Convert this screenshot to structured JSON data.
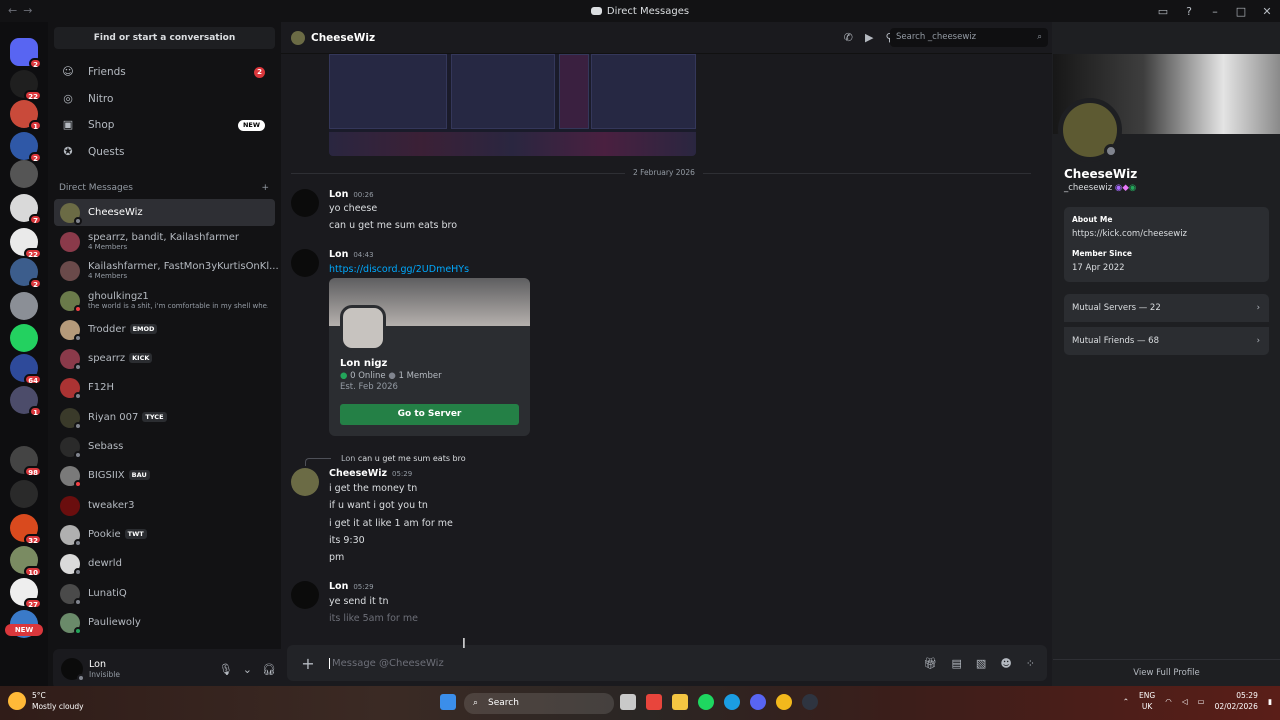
{
  "titlebar": {
    "title": "Direct Messages",
    "back": "←",
    "fwd": "→"
  },
  "servers": [
    {
      "badge": "2",
      "color": "#5865f2"
    },
    {
      "badge": "22",
      "color": "#1f1f1f"
    },
    {
      "badge": "1",
      "color": "#c94a3a"
    },
    {
      "badge": "2",
      "color": "#2f58a7"
    },
    {
      "badge": "",
      "color": "#555555"
    },
    {
      "badge": "7",
      "color": "#d9d9d9"
    },
    {
      "badge": "22",
      "color": "#eaeaea"
    },
    {
      "badge": "2",
      "color": "#3c5d8c"
    },
    {
      "badge": "",
      "color": "#8b8f96"
    },
    {
      "badge": "",
      "color": "#23d160"
    },
    {
      "badge": "64",
      "color": "#2e4a9a"
    },
    {
      "badge": "1",
      "color": "#4c4c6a"
    },
    {
      "badge": "98",
      "color": "#444444"
    },
    {
      "badge": "",
      "color": "#2a2a2a"
    },
    {
      "badge": "32",
      "color": "#d94a1e"
    },
    {
      "badge": "10",
      "color": "#7a8b62"
    },
    {
      "badge": "27",
      "color": "#eeeeee"
    },
    {
      "badge": "",
      "color": "#3a7ac9"
    }
  ],
  "servers_new": "NEW",
  "dmpanel": {
    "search_label": "Find or start a conversation",
    "nav": [
      {
        "label": "Friends",
        "icon": "friends-icon",
        "glyph": "☺",
        "badge": "2"
      },
      {
        "label": "Nitro",
        "icon": "nitro-icon",
        "glyph": "◎",
        "badge": ""
      },
      {
        "label": "Shop",
        "icon": "shop-icon",
        "glyph": "▣",
        "tag": "NEW"
      },
      {
        "label": "Quests",
        "icon": "quests-icon",
        "glyph": "✪",
        "badge": ""
      }
    ],
    "dm_header": "Direct Messages",
    "dm_add": "+",
    "dms": [
      {
        "name": "CheeseWiz",
        "sub": "",
        "tag": "",
        "color": "#6b6b45",
        "status": "#80848e"
      },
      {
        "name": "spearrz, bandit, Kailashfarmer",
        "sub": "4 Members",
        "tag": "",
        "color": "#8a3a4a",
        "status": ""
      },
      {
        "name": "Kailashfarmer, FastMon3yKurtisOnKl...",
        "sub": "4 Members",
        "tag": "",
        "color": "#6a4a4a",
        "status": ""
      },
      {
        "name": "ghoulkingz1",
        "sub": "the world is a shit, i'm comfortable in my shell whe...",
        "tag": "",
        "color": "#6a7a4a",
        "status": "#f23f43"
      },
      {
        "name": "Trodder",
        "sub": "",
        "tag": "EMOD",
        "color": "#b59a7a",
        "status": "#80848e"
      },
      {
        "name": "spearrz",
        "sub": "",
        "tag": "KICK",
        "color": "#8a3a4a",
        "status": "#80848e"
      },
      {
        "name": "F12H",
        "sub": "",
        "tag": "",
        "color": "#aa3333",
        "status": "#80848e"
      },
      {
        "name": "Riyan 007",
        "sub": "",
        "tag": "TYCE",
        "color": "#3a3a2a",
        "status": "#80848e"
      },
      {
        "name": "Sebass",
        "sub": "",
        "tag": "",
        "color": "#2a2a2a",
        "status": "#80848e"
      },
      {
        "name": "BIGSIIX",
        "sub": "",
        "tag": "BAU",
        "color": "#7a7a7a",
        "status": "#f23f43"
      },
      {
        "name": "tweaker3",
        "sub": "",
        "tag": "",
        "color": "#6a0e0e",
        "status": ""
      },
      {
        "name": "Pookie",
        "sub": "",
        "tag": "TWT",
        "color": "#b0b0b0",
        "status": "#80848e"
      },
      {
        "name": "dewrld",
        "sub": "",
        "tag": "",
        "color": "#dadada",
        "status": "#80848e"
      },
      {
        "name": "LunatiQ",
        "sub": "",
        "tag": "",
        "color": "#4a4a4a",
        "status": "#80848e"
      },
      {
        "name": "Pauliewoly",
        "sub": "",
        "tag": "",
        "color": "#6a8a6a",
        "status": "#23a55a"
      }
    ],
    "user": {
      "name": "Lon",
      "status": "Invisible"
    }
  },
  "chat": {
    "name": "CheeseWiz",
    "search_placeholder": "Search _cheesewiz",
    "divider": "2 February 2026",
    "messages": [
      {
        "author": "Lon",
        "time": "00:26",
        "lines": [
          "yo cheese",
          "can u get me sum eats bro"
        ]
      },
      {
        "author": "Lon",
        "time": "04:43",
        "link": "https://discord.gg/2UDmeHYs"
      },
      {
        "author": "CheeseWiz",
        "time": "05:29",
        "lines": [
          "i get the money tn",
          "if u want i got you tn",
          "i get it at like 1 am for me",
          "its 9:30",
          "pm"
        ]
      },
      {
        "author": "Lon",
        "time": "05:29",
        "lines": [
          "ye send it tn",
          "its like 5am for me"
        ]
      }
    ],
    "reply": {
      "author": "Lon",
      "text": "can u get me sum eats bro"
    },
    "embed": {
      "name": "Lon nigz",
      "online": "0 Online",
      "members": "1 Member",
      "est": "Est. Feb 2026",
      "button": "Go to Server"
    },
    "composer_placeholder": "Message @CheeseWiz"
  },
  "profile": {
    "name": "CheeseWiz",
    "username": "_cheesewiz",
    "about_label": "About Me",
    "about_link": "https://kick.com/cheesewiz",
    "member_since_label": "Member Since",
    "member_since": "17 Apr 2022",
    "mutual_servers": "Mutual Servers — 22",
    "mutual_friends": "Mutual Friends — 68",
    "view_full": "View Full Profile"
  },
  "taskbar": {
    "temp": "5°C",
    "weather": "Mostly cloudy",
    "search": "Search",
    "lang1": "ENG",
    "lang2": "UK",
    "time": "05:29",
    "date": "02/02/2026"
  }
}
